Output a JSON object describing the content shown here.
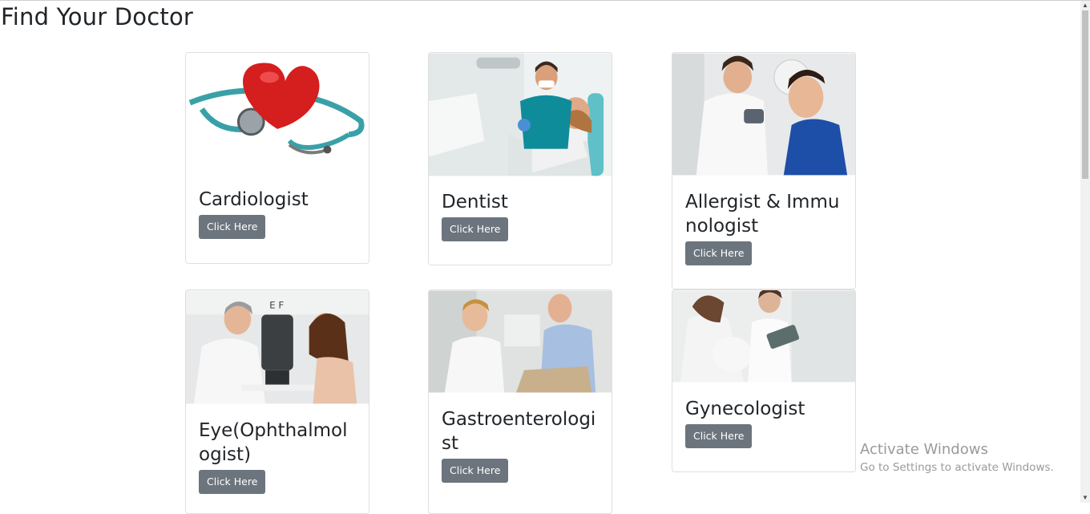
{
  "page": {
    "title": "Find Your Doctor"
  },
  "cards": [
    {
      "title": "Cardiologist",
      "button": "Click Here",
      "image": "heart-stethoscope-image"
    },
    {
      "title": "Dentist",
      "button": "Click Here",
      "image": "dentist-patient-image"
    },
    {
      "title": "Allergist & Immunologist",
      "button": "Click Here",
      "image": "doctor-child-image"
    },
    {
      "title": "Eye(Ophthalmologist)",
      "button": "Click Here",
      "image": "eye-exam-image"
    },
    {
      "title": "Gastroenterologist",
      "button": "Click Here",
      "image": "gastro-consult-image"
    },
    {
      "title": "Gynecologist",
      "button": "Click Here",
      "image": "pregnant-patient-image"
    }
  ],
  "watermark": {
    "title": "Activate Windows",
    "subtitle": "Go to Settings to activate Windows."
  },
  "colors": {
    "button": "#6c757d",
    "text": "#212529",
    "card_border": "#dfdfdf"
  }
}
